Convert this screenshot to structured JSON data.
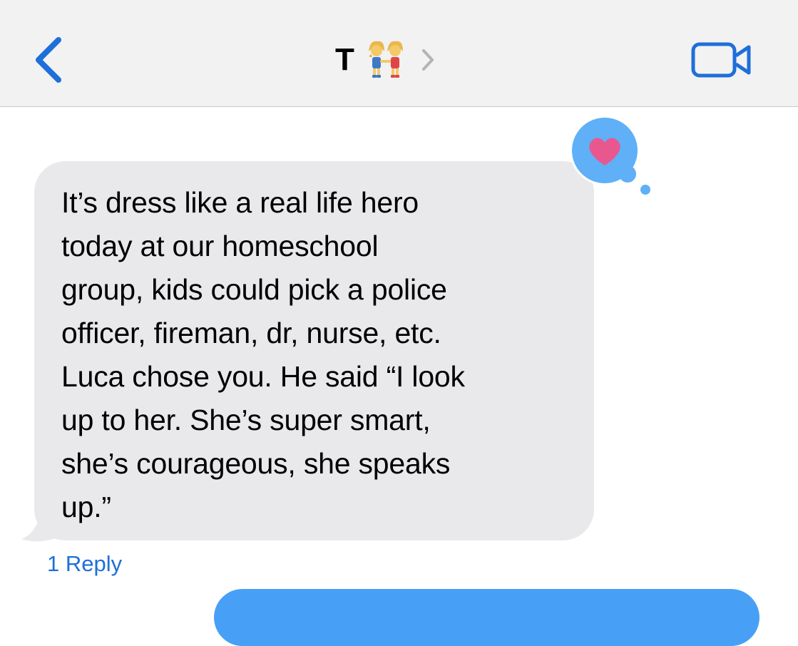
{
  "header": {
    "contact_name": "T",
    "contact_avatar_icon": "two-women-holding-hands-icon",
    "chevron_icon": "chevron-right-icon",
    "back_icon": "chevron-left-icon",
    "video_icon": "video-camera-icon"
  },
  "message": {
    "text": "It’s dress like a real life hero\ntoday at our homeschool\ngroup, kids could pick a police\nofficer, fireman, dr, nurse, etc.\nLuca chose you. He said “I look\nup to her. She’s super smart,\nshe’s courageous, she speaks\nup.”",
    "tapback_icon": "heart-icon",
    "reply_label": "1 Reply"
  },
  "colors": {
    "accent": "#1e6fd9",
    "incoming_bubble": "#e9e9eb",
    "outgoing_bubble": "#47a0f5",
    "tapback_bubble": "#5fb0f6",
    "heart": "#e9578f",
    "header_bg": "#f2f2f2"
  }
}
